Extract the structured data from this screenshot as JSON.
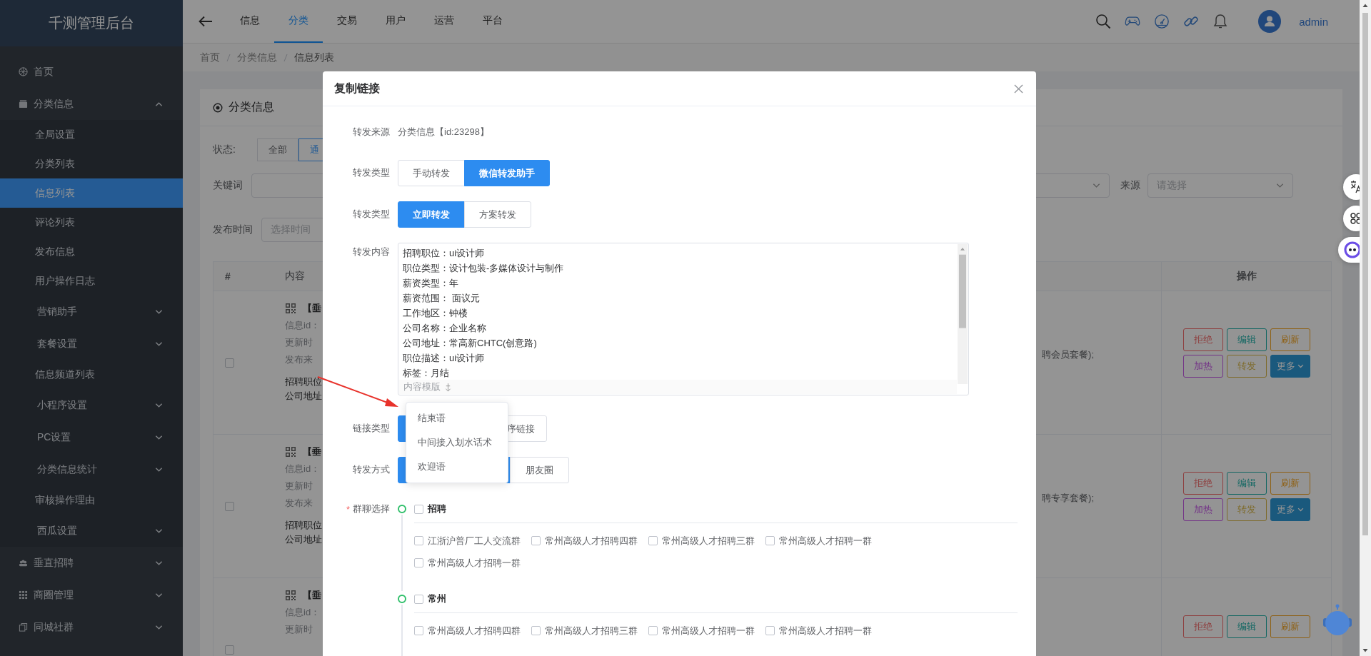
{
  "sidebar": {
    "title": "千测管理后台",
    "items": [
      {
        "label": "首页",
        "kind": "link",
        "selected": false
      },
      {
        "label": "分类信息",
        "kind": "group",
        "expanded": true,
        "selected": false,
        "children": [
          {
            "label": "全局设置",
            "kind": "link",
            "selected": false
          },
          {
            "label": "分类列表",
            "kind": "link",
            "selected": false
          },
          {
            "label": "信息列表",
            "kind": "link",
            "selected": true
          },
          {
            "label": "评论列表",
            "kind": "link",
            "selected": false
          },
          {
            "label": "发布信息",
            "kind": "link",
            "selected": false
          },
          {
            "label": "用户操作日志",
            "kind": "link",
            "selected": false
          },
          {
            "label": "营销助手",
            "kind": "group",
            "expanded": false,
            "selected": false
          },
          {
            "label": "套餐设置",
            "kind": "group",
            "expanded": false,
            "selected": false
          },
          {
            "label": "信息频道列表",
            "kind": "link",
            "selected": false
          },
          {
            "label": "小程序设置",
            "kind": "group",
            "expanded": false,
            "selected": false
          },
          {
            "label": "PC设置",
            "kind": "group",
            "expanded": false,
            "selected": false
          },
          {
            "label": "分类信息统计",
            "kind": "group",
            "expanded": false,
            "selected": false
          },
          {
            "label": "审核操作理由",
            "kind": "link",
            "selected": false
          },
          {
            "label": "西瓜设置",
            "kind": "group",
            "expanded": false,
            "selected": false
          }
        ]
      },
      {
        "label": "垂直招聘",
        "kind": "group",
        "expanded": false,
        "selected": false
      },
      {
        "label": "商圈管理",
        "kind": "group",
        "expanded": false,
        "selected": false
      },
      {
        "label": "同城社群",
        "kind": "group",
        "expanded": false,
        "selected": false
      }
    ]
  },
  "topbar": {
    "tabs": [
      {
        "label": "信息",
        "selected": false
      },
      {
        "label": "分类",
        "selected": true
      },
      {
        "label": "交易",
        "selected": false
      },
      {
        "label": "用户",
        "selected": false
      },
      {
        "label": "运营",
        "selected": false
      },
      {
        "label": "平台",
        "selected": false
      }
    ],
    "user": "admin"
  },
  "breadcrumb": [
    "首页",
    "分类信息",
    "信息列表"
  ],
  "panel": {
    "title": "分类信息",
    "status_label": "状态:",
    "status_options": [
      {
        "label": "全部",
        "selected": false
      },
      {
        "label": "通",
        "selected": true
      }
    ],
    "keyword_label": "关键词",
    "time_label": "发布时间",
    "time_placeholder": "选择时间",
    "source_label": "来源",
    "source_placeholder": "请选择",
    "table": {
      "columns": [
        "#",
        "内容",
        "操作"
      ],
      "rows": [
        {
          "checked": false,
          "title": "【垂",
          "lines": [
            "信息id：",
            "更新时",
            "发布来"
          ],
          "body": [
            "招聘职位",
            "公司地址"
          ],
          "tail": "聘会员套餐);",
          "actions": [
            {
              "label": "拒绝",
              "kind": "reject"
            },
            {
              "label": "编辑",
              "kind": "edit"
            },
            {
              "label": "刷新",
              "kind": "refresh"
            },
            {
              "label": "加热",
              "kind": "boost"
            },
            {
              "label": "转发",
              "kind": "forward"
            },
            {
              "label": "更多",
              "kind": "more"
            }
          ]
        },
        {
          "checked": false,
          "title": "【垂",
          "lines": [
            "信息id：",
            "更新时",
            "发布来"
          ],
          "body": [
            "招聘职位",
            "公司地址"
          ],
          "tail": "聘专享套餐);",
          "actions": [
            {
              "label": "拒绝",
              "kind": "reject"
            },
            {
              "label": "编辑",
              "kind": "edit"
            },
            {
              "label": "刷新",
              "kind": "refresh"
            },
            {
              "label": "加热",
              "kind": "boost"
            },
            {
              "label": "转发",
              "kind": "forward"
            },
            {
              "label": "更多",
              "kind": "more"
            }
          ]
        },
        {
          "checked": false,
          "title": "【垂",
          "lines": [
            "信息id：",
            "更新时"
          ],
          "body": [],
          "actions": [
            {
              "label": "拒绝",
              "kind": "reject"
            },
            {
              "label": "编辑",
              "kind": "edit"
            },
            {
              "label": "刷新",
              "kind": "refresh"
            }
          ]
        }
      ]
    }
  },
  "dialog": {
    "title": "复制链接",
    "fields": [
      {
        "kind": "text",
        "label": "转发来源",
        "value": "分类信息【id:23298】"
      },
      {
        "kind": "segmented",
        "label": "转发类型",
        "options": [
          {
            "label": "手动转发",
            "selected": false
          },
          {
            "label": "微信转发助手",
            "selected": true
          }
        ]
      },
      {
        "kind": "segmented",
        "label": "转发类型",
        "options": [
          {
            "label": "立即转发",
            "selected": true
          },
          {
            "label": "方案转发",
            "selected": false
          }
        ]
      },
      {
        "kind": "textarea",
        "label": "转发内容",
        "lines": [
          "招聘职位：ui设计师",
          "职位类型：设计包装-多媒体设计与制作",
          "薪资类型：年",
          "薪资范围： 面议元",
          "工作地区：钟楼",
          "公司名称：企业名称",
          "公司地址：常高新CHTC(创意路)",
          "职位描述：ui设计师",
          "标签：月结"
        ],
        "template_button": "内容模版"
      },
      {
        "kind": "segmented",
        "label": "链接类型",
        "options": [
          {
            "selected": true
          },
          {
            "label": "序链接",
            "selected": false
          }
        ]
      },
      {
        "kind": "segmented",
        "label": "转发方式",
        "options": [
          {
            "selected": true
          },
          {
            "label": "朋友圈",
            "selected": false
          }
        ]
      },
      {
        "kind": "groups",
        "label": "群聊选择",
        "marker": "*",
        "groups": [
          {
            "name": "招聘",
            "checked": false,
            "members": [
              {
                "label": "江浙沪普厂工人交流群",
                "checked": false
              },
              {
                "label": "常州高级人才招聘四群",
                "checked": false
              },
              {
                "label": "常州高级人才招聘三群",
                "checked": false
              },
              {
                "label": "常州高级人才招聘一群",
                "checked": false
              },
              {
                "label": "常州高级人才招聘一群",
                "checked": false
              }
            ]
          },
          {
            "name": "常州",
            "checked": false,
            "members": [
              {
                "label": "常州高级人才招聘四群",
                "checked": false
              },
              {
                "label": "常州高级人才招聘三群",
                "checked": false
              },
              {
                "label": "常州高级人才招聘一群",
                "checked": false
              },
              {
                "label": "常州高级人才招聘一群",
                "checked": false
              }
            ]
          }
        ]
      }
    ],
    "dropdown": [
      "结束语",
      "中间接入划水话术",
      "欢迎语"
    ]
  }
}
